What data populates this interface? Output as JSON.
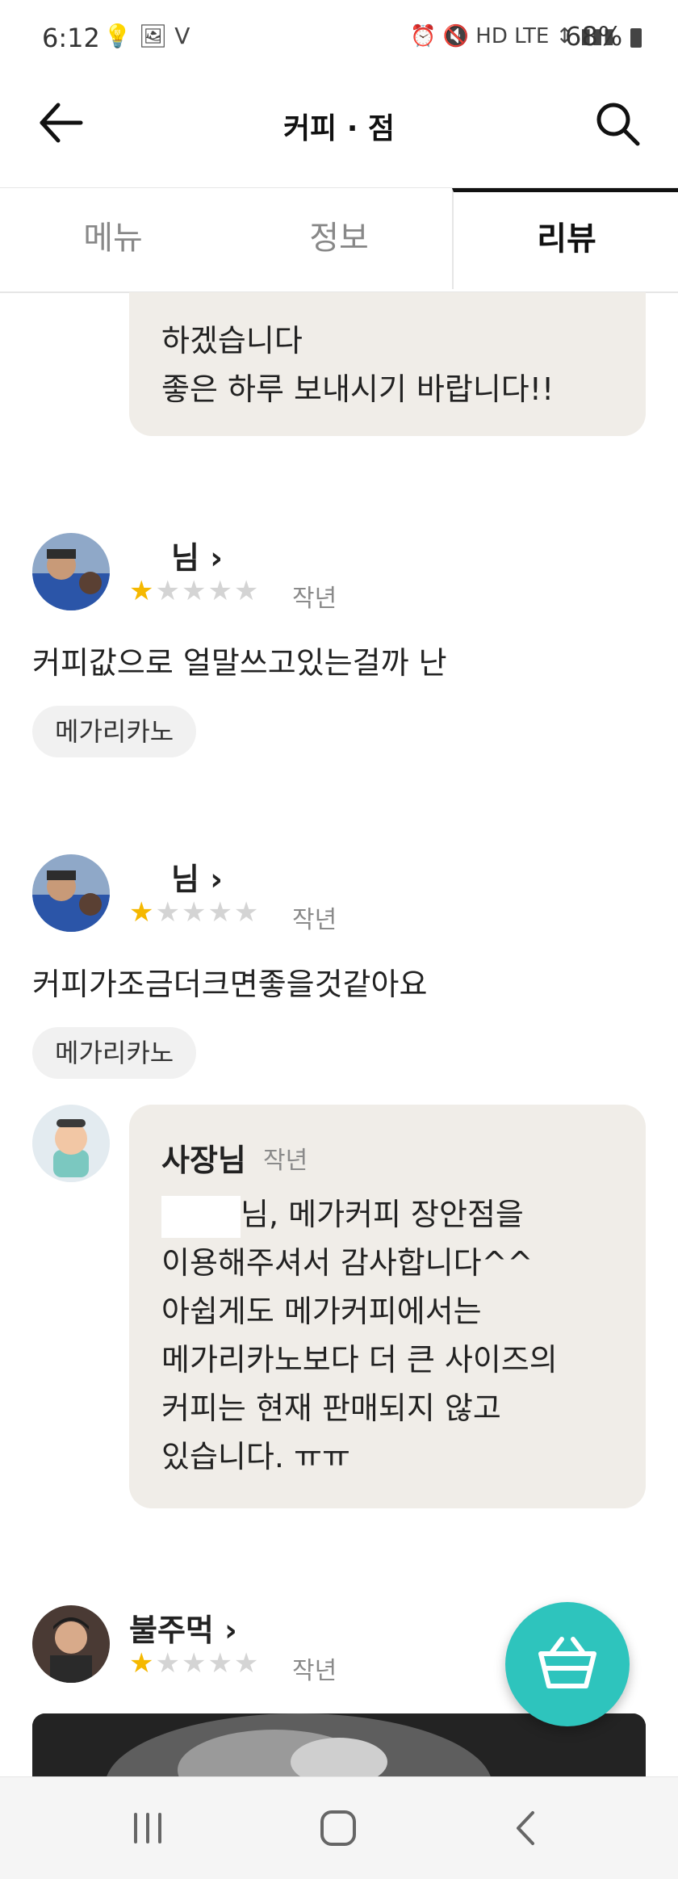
{
  "status_bar": {
    "time": "6:12",
    "left_icons": "💡 🖼 V",
    "right_icons": "⏰ 🔇 HD LTE ↕ ▮▮▮",
    "battery": "68%"
  },
  "app_bar": {
    "title": "커피 ·     점",
    "back_icon": "arrow-left-icon",
    "search_icon": "search-icon"
  },
  "tabs": [
    {
      "label": "메뉴"
    },
    {
      "label": "정보"
    },
    {
      "label": "리뷰"
    }
  ],
  "top_reply": {
    "lines": [
      "하겠습니다",
      "좋은 하루 보내시기 바랍니다!!"
    ]
  },
  "reviews": [
    {
      "name": "님 ›",
      "rating": 1,
      "date": "작년",
      "text": "커피값으로 얼말쓰고있는걸까 난",
      "menu_tag": "메가리카노"
    },
    {
      "name": "님 ›",
      "rating": 1,
      "date": "작년",
      "text": "커피가조금더크면좋을것같아요",
      "menu_tag": "메가리카노",
      "owner_reply": {
        "name": "사장님",
        "date": "작년",
        "lines": [
          "님, 메가커피 장안점을",
          "이용해주셔서 감사합니다^^",
          "아쉽게도 메가커피에서는",
          "메가리카노보다 더 큰 사이즈의",
          "커피는 현재 판매되지 않고",
          "있습니다. ㅠㅠ"
        ]
      }
    },
    {
      "name": "불주먹 ›",
      "rating": 1,
      "date": "작년"
    }
  ],
  "fab": {
    "icon": "shopping-basket-icon"
  },
  "nav_bar": {
    "recent_icon": "recent-apps-icon",
    "home_icon": "home-icon",
    "back_icon": "nav-back-icon"
  }
}
